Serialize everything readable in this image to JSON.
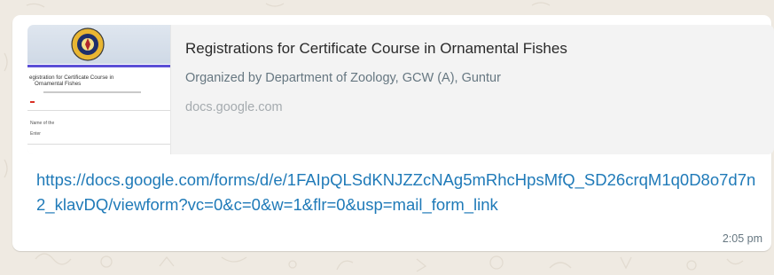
{
  "chat": {
    "background_color": "#efeae2",
    "message": {
      "preview": {
        "thumbnail": {
          "form_title": "egistration for Certificate Course in",
          "form_subtitle": "Ornamental Fishes",
          "small_text_1": "Name of the",
          "small_text_2": "Enter"
        },
        "title": "Registrations for Certificate Course in Ornamental Fishes",
        "description": "Organized by Department of Zoology, GCW (A), Guntur",
        "domain": "docs.google.com"
      },
      "link": "https://docs.google.com/forms/d/e/1FAIpQLSdKNJZZcNAg5mRhcHpsMfQ_SD26crqM1q0D8o7d7n2_klavDQ/viewform?vc=0&c=0&w=1&flr=0&usp=mail_form_link",
      "time": "2:05 pm",
      "link_color": "#1f7ab8"
    }
  }
}
